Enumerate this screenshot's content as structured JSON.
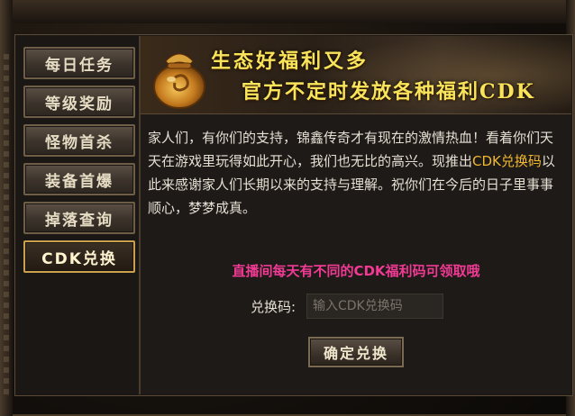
{
  "sidebar": {
    "items": [
      {
        "label": "每日任务"
      },
      {
        "label": "等级奖励"
      },
      {
        "label": "怪物首杀"
      },
      {
        "label": "装备首爆"
      },
      {
        "label": "掉落查询"
      },
      {
        "label": "CDK兑换"
      }
    ],
    "active_index": 5
  },
  "banner": {
    "line1": "生态好福利又多",
    "line2": "官方不定时发放各种福利CDK",
    "icon": "treasure-bag-icon"
  },
  "description": {
    "part1": "家人们，有你们的支持，锦鑫传奇才有现在的激情热血！看着你们天天在游戏里玩得如此开心，我们也无比的高兴。现推出",
    "highlight": "CDK兑换码",
    "part2": "以此来感谢家人们长期以来的支持与理解。祝你们在今后的日子里事事顺心，梦梦成真。"
  },
  "live_note": "直播间每天有不同的CDK福利码可领取哦",
  "redeem": {
    "label": "兑换码:",
    "placeholder": "输入CDK兑换码",
    "value": "",
    "button_label": "确定兑换"
  },
  "colors": {
    "highlight": "#f2b830",
    "live_note": "#f03a94",
    "banner_text": "#f7e45a"
  }
}
